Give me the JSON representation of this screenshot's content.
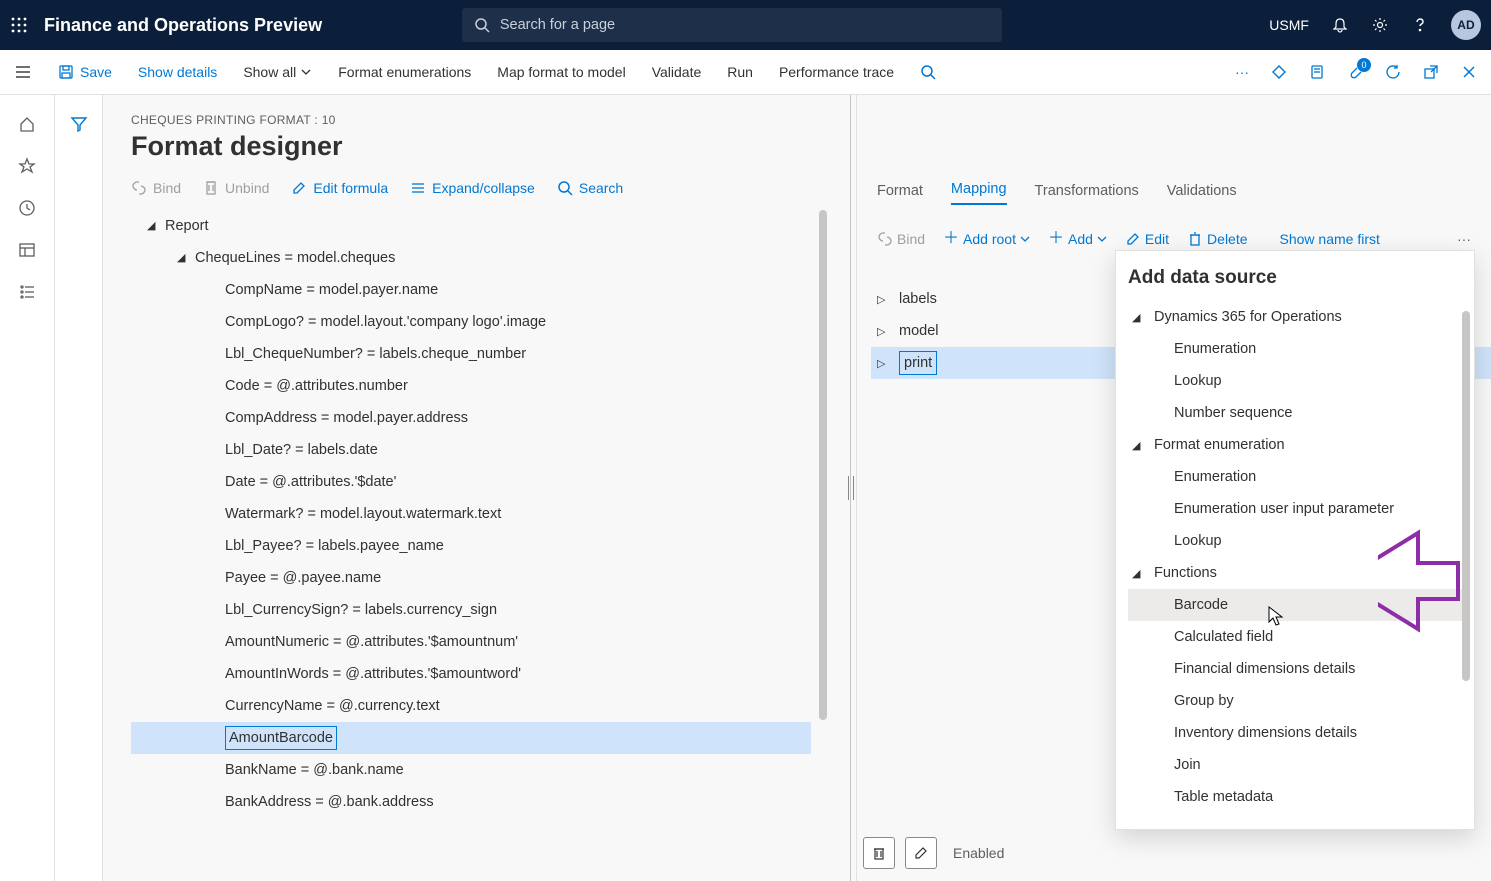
{
  "topbar": {
    "app_title": "Finance and Operations Preview",
    "search_placeholder": "Search for a page",
    "company": "USMF",
    "avatar_initials": "AD"
  },
  "cmdbar": {
    "save": "Save",
    "show_details": "Show details",
    "show_all": "Show all",
    "format_enumerations": "Format enumerations",
    "map_format": "Map format to model",
    "validate": "Validate",
    "run": "Run",
    "performance_trace": "Performance trace",
    "badge_count": "0"
  },
  "page": {
    "breadcrumb": "CHEQUES PRINTING FORMAT : 10",
    "title": "Format designer"
  },
  "toolbar_left": {
    "bind": "Bind",
    "unbind": "Unbind",
    "edit_formula": "Edit formula",
    "expand_collapse": "Expand/collapse",
    "search": "Search"
  },
  "tree": {
    "root": "Report",
    "cheque_lines": "ChequeLines = model.cheques",
    "items": [
      "CompName = model.payer.name",
      "CompLogo? = model.layout.'company logo'.image",
      "Lbl_ChequeNumber? = labels.cheque_number",
      "Code = @.attributes.number",
      "CompAddress = model.payer.address",
      "Lbl_Date? = labels.date",
      "Date = @.attributes.'$date'",
      "Watermark? = model.layout.watermark.text",
      "Lbl_Payee? = labels.payee_name",
      "Payee = @.payee.name",
      "Lbl_CurrencySign? = labels.currency_sign",
      "AmountNumeric = @.attributes.'$amountnum'",
      "AmountInWords = @.attributes.'$amountword'",
      "CurrencyName = @.currency.text",
      "AmountBarcode",
      "BankName = @.bank.name",
      "BankAddress = @.bank.address"
    ],
    "selected_index": 14
  },
  "right_tabs": {
    "format": "Format",
    "mapping": "Mapping",
    "transformations": "Transformations",
    "validations": "Validations"
  },
  "right_cmdbar": {
    "bind": "Bind",
    "add_root": "Add root",
    "add": "Add",
    "edit": "Edit",
    "delete": "Delete",
    "show_name_first": "Show name first"
  },
  "ds_list": {
    "items": [
      "labels",
      "model",
      "print"
    ],
    "selected_index": 2
  },
  "popup": {
    "title": "Add data source",
    "group1": "Dynamics 365 for Operations",
    "group1_items": [
      "Enumeration",
      "Lookup",
      "Number sequence"
    ],
    "group2": "Format enumeration",
    "group2_items": [
      "Enumeration",
      "Enumeration user input parameter",
      "Lookup"
    ],
    "group3": "Functions",
    "group3_items": [
      "Barcode",
      "Calculated field",
      "Financial dimensions details",
      "Group by",
      "Inventory dimensions details",
      "Join",
      "Table metadata"
    ],
    "hover_item": "Barcode"
  },
  "footer": {
    "enabled_label": "Enabled"
  }
}
